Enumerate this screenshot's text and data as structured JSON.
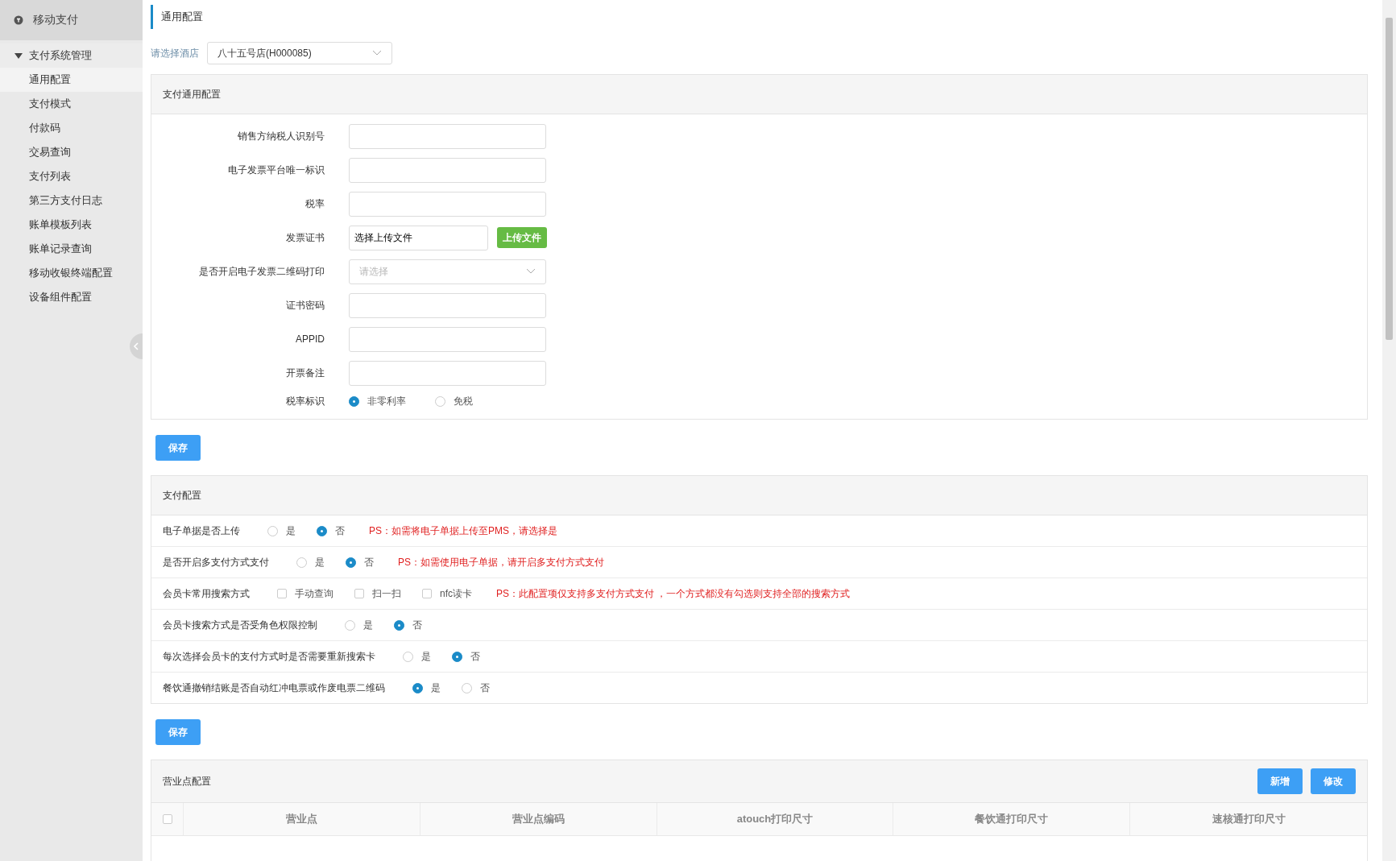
{
  "sidebar": {
    "title": "移动支付",
    "group": {
      "label": "支付系统管理",
      "expanded": true,
      "items": [
        {
          "label": "通用配置",
          "selected": true
        },
        {
          "label": "支付模式",
          "selected": false
        },
        {
          "label": "付款码",
          "selected": false
        },
        {
          "label": "交易查询",
          "selected": false
        },
        {
          "label": "支付列表",
          "selected": false
        },
        {
          "label": "第三方支付日志",
          "selected": false
        },
        {
          "label": "账单模板列表",
          "selected": false
        },
        {
          "label": "账单记录查询",
          "selected": false
        },
        {
          "label": "移动收银终端配置",
          "selected": false
        },
        {
          "label": "设备组件配置",
          "selected": false
        }
      ]
    }
  },
  "page_title": "通用配置",
  "hotel_select": {
    "label": "请选择酒店",
    "value": "八十五号店(H000085)"
  },
  "general_config": {
    "title": "支付通用配置",
    "fields": [
      {
        "kind": "text",
        "label": "销售方纳税人识别号"
      },
      {
        "kind": "text",
        "label": "电子发票平台唯一标识"
      },
      {
        "kind": "text",
        "label": "税率"
      },
      {
        "kind": "file",
        "label": "发票证书",
        "value": "选择上传文件",
        "button": "上传文件"
      },
      {
        "kind": "select",
        "label": "是否开启电子发票二维码打印",
        "placeholder": "请选择"
      },
      {
        "kind": "text",
        "label": "证书密码"
      },
      {
        "kind": "text",
        "label": "APPID"
      },
      {
        "kind": "text",
        "label": "开票备注"
      },
      {
        "kind": "radio",
        "label": "税率标识",
        "options": [
          {
            "label": "非零利率",
            "selected": true
          },
          {
            "label": "免税",
            "selected": false
          }
        ]
      }
    ]
  },
  "save_button": "保存",
  "payment_config": {
    "title": "支付配置",
    "rows": [
      {
        "kind": "radio",
        "label": "电子单据是否上传",
        "options": [
          {
            "label": "是",
            "selected": false
          },
          {
            "label": "否",
            "selected": true
          }
        ],
        "note": "PS：如需将电子单据上传至PMS，请选择是"
      },
      {
        "kind": "radio",
        "label": "是否开启多支付方式支付",
        "options": [
          {
            "label": "是",
            "selected": false
          },
          {
            "label": "否",
            "selected": true
          }
        ],
        "note": "PS：如需使用电子单据，请开启多支付方式支付"
      },
      {
        "kind": "checkbox",
        "label": "会员卡常用搜索方式",
        "options": [
          {
            "label": "手动查询",
            "checked": false
          },
          {
            "label": "扫一扫",
            "checked": false
          },
          {
            "label": "nfc读卡",
            "checked": false
          }
        ],
        "note": "PS：此配置项仅支持多支付方式支付 ，一个方式都没有勾选则支持全部的搜索方式"
      },
      {
        "kind": "radio",
        "label": "会员卡搜索方式是否受角色权限控制",
        "options": [
          {
            "label": "是",
            "selected": false
          },
          {
            "label": "否",
            "selected": true
          }
        ]
      },
      {
        "kind": "radio",
        "label": "每次选择会员卡的支付方式时是否需要重新搜索卡",
        "options": [
          {
            "label": "是",
            "selected": false
          },
          {
            "label": "否",
            "selected": true
          }
        ]
      },
      {
        "kind": "radio",
        "label": "餐饮通撤销结账是否自动红冲电票或作废电票二维码",
        "options": [
          {
            "label": "是",
            "selected": true
          },
          {
            "label": "否",
            "selected": false
          }
        ]
      }
    ]
  },
  "save_button_2": "保存",
  "outlet_config": {
    "title": "营业点配置",
    "buttons": [
      "新增",
      "修改"
    ],
    "table": {
      "select_all_checked": false,
      "columns": [
        "营业点",
        "营业点编码",
        "atouch打印尺寸",
        "餐饮通打印尺寸",
        "速核通打印尺寸"
      ]
    }
  }
}
